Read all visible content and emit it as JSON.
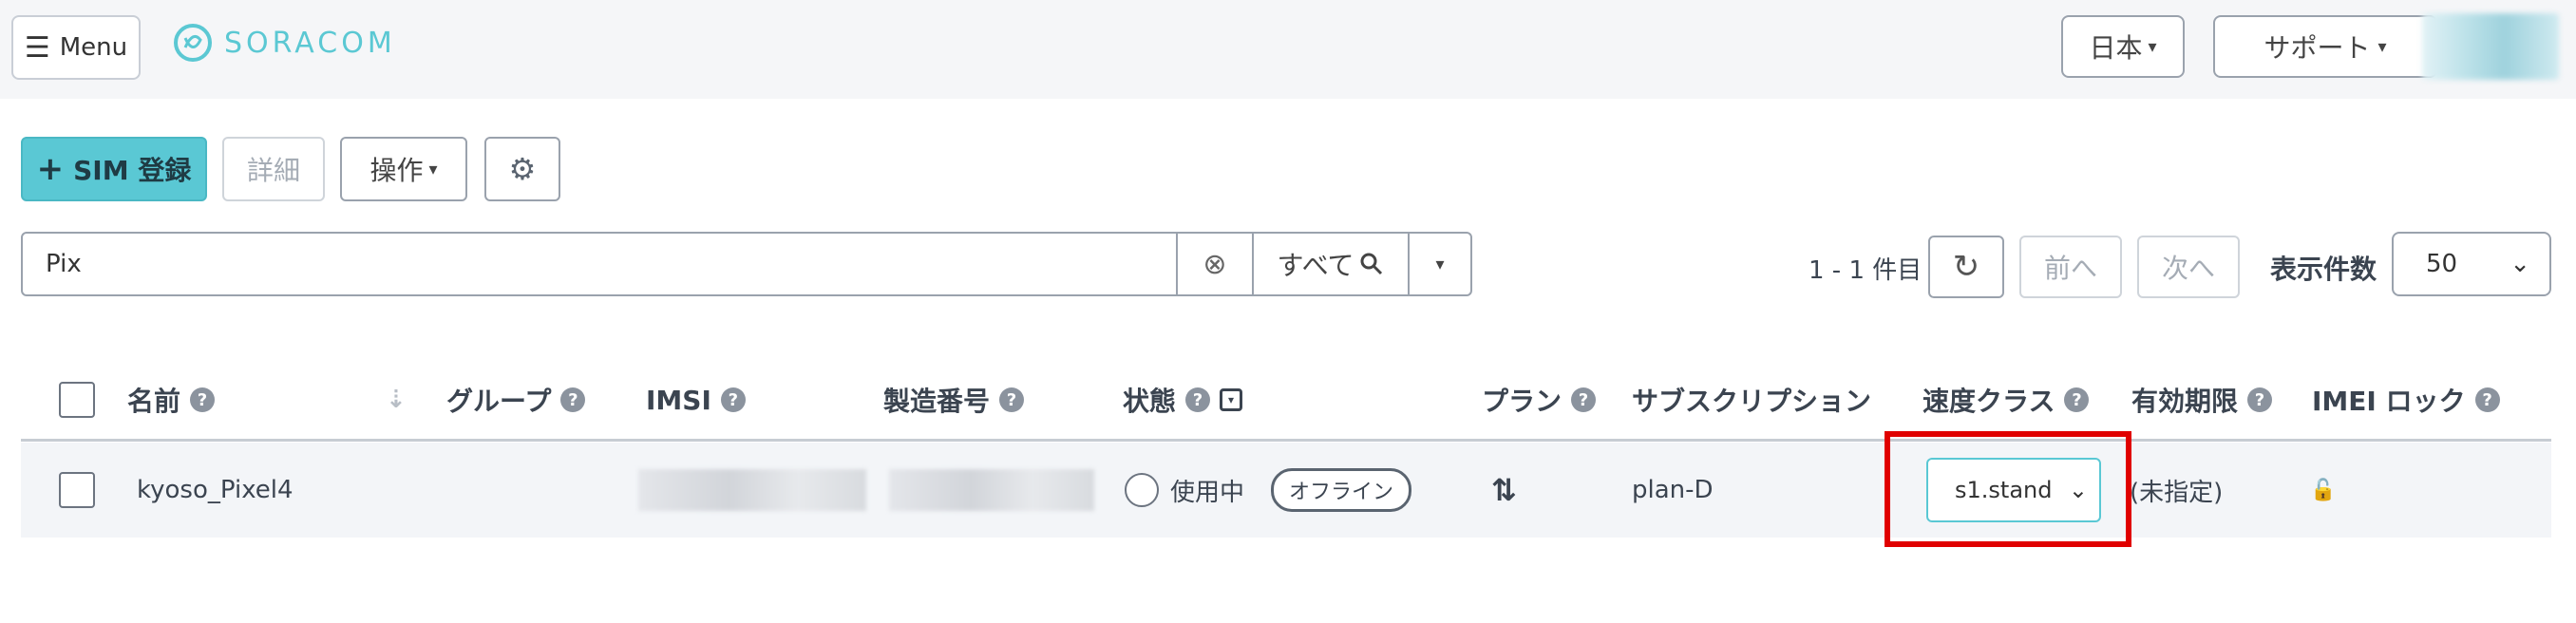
{
  "header": {
    "menu_label": "Menu",
    "brand": "SORACOM",
    "language_label": "日本",
    "support_label": "サポート"
  },
  "toolbar": {
    "sim_register_label": "SIM 登録",
    "detail_label": "詳細",
    "operations_label": "操作"
  },
  "search": {
    "value": "Pix",
    "scope_label": "すべて"
  },
  "pagination": {
    "count_text": "1 - 1 件目",
    "prev_label": "前へ",
    "next_label": "次へ",
    "per_page_label": "表示件数",
    "per_page_value": "50"
  },
  "table": {
    "columns": {
      "name": "名前",
      "group": "グループ",
      "imsi": "IMSI",
      "serial": "製造番号",
      "status": "状態",
      "plan": "プラン",
      "subscription": "サブスクリプション",
      "speed_class": "速度クラス",
      "expiry": "有効期限",
      "imei_lock": "IMEI ロック"
    },
    "rows": [
      {
        "name": "kyoso_Pixel4",
        "status": "使用中",
        "online_badge": "オフライン",
        "subscription": "plan-D",
        "speed_class": "s1.stand",
        "expiry": "(未指定)"
      }
    ]
  },
  "colors": {
    "accent": "#5ac8d4",
    "highlight": "#e00000"
  }
}
